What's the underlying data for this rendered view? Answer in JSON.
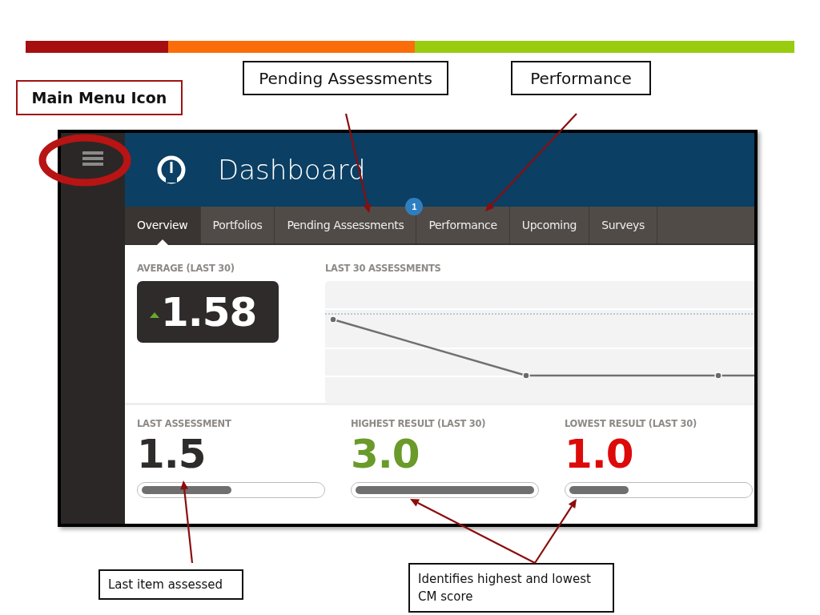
{
  "callouts": [
    {
      "text": "Main Menu Icon",
      "kind": "emphasis"
    },
    {
      "text": "Pending Assessments",
      "kind": "plain"
    },
    {
      "text": "Performance",
      "kind": "plain"
    },
    {
      "text": "Last item assessed",
      "kind": "note"
    },
    {
      "text": "Identifies highest and lowest CM score",
      "kind": "note"
    }
  ],
  "app": {
    "title": "Dashboard",
    "tabs": [
      {
        "label": "Overview",
        "selected": true
      },
      {
        "label": "Portfolios",
        "selected": false
      },
      {
        "label": "Pending Assessments",
        "selected": false,
        "badge": "1"
      },
      {
        "label": "Performance",
        "selected": false
      },
      {
        "label": "Upcoming",
        "selected": false
      },
      {
        "label": "Surveys",
        "selected": false
      }
    ],
    "average": {
      "label": "AVERAGE (LAST 30)",
      "value": "1.58",
      "rising": true
    },
    "chart": {
      "title": "LAST 30 ASSESSMENTS"
    },
    "stats": [
      {
        "label": "LAST ASSESSMENT",
        "value": "1.5",
        "color": "#2e2c2b",
        "level": 0.5
      },
      {
        "label": "HIGHEST RESULT (LAST 30)",
        "value": "3.0",
        "color": "#6a9a2a",
        "level": 1.0
      },
      {
        "label": "LOWEST RESULT (LAST 30)",
        "value": "1.0",
        "color": "#dd0a0a",
        "level": 0.33
      }
    ]
  }
}
